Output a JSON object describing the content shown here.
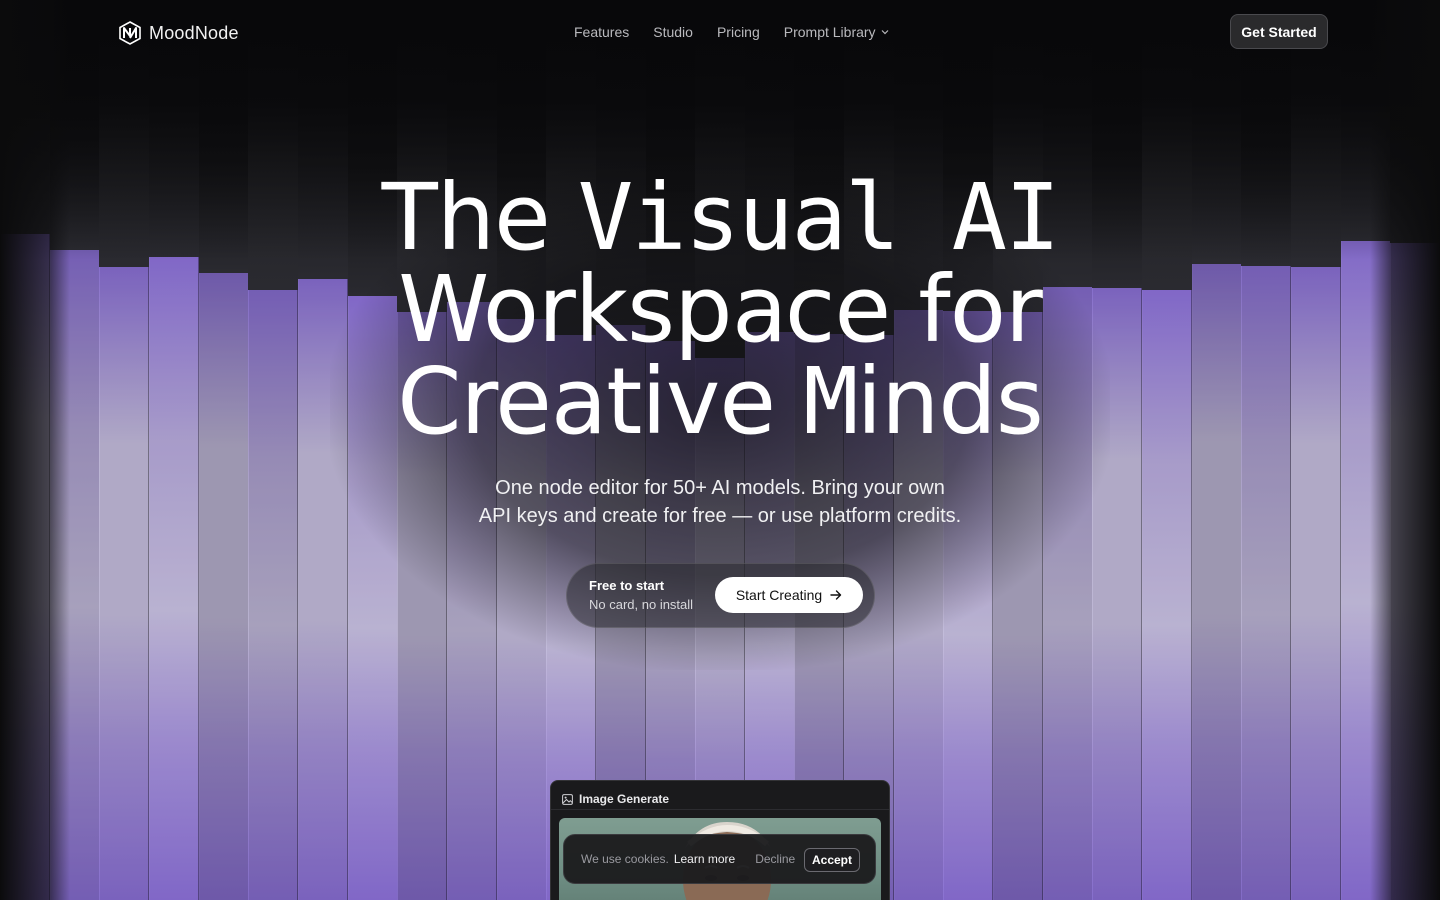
{
  "nav": {
    "brand_name": "MoodNode",
    "links": [
      {
        "label": "Features"
      },
      {
        "label": "Studio"
      },
      {
        "label": "Pricing"
      },
      {
        "label": "Prompt Library"
      }
    ],
    "cta_label": "Get Started"
  },
  "hero": {
    "title_line_1_a": "The ",
    "title_line_1_b": "Visual AI",
    "title_line_2_a": "Worksp",
    "title_line_2_b": "a",
    "title_line_2_c": "ce for",
    "title_line_3_a": "Creative ",
    "title_line_3_b": "M",
    "title_line_3_c": "inds",
    "subtitle_line_1": "One node editor for 50+ AI models. Bring your own",
    "subtitle_line_2": "API keys and create for free — or use platform credits."
  },
  "cta": {
    "note_title": "Free to start",
    "note_sub": "No card, no install",
    "button_label": "Start Creating"
  },
  "node_card": {
    "title": "Image Generate",
    "icon": "image-icon"
  },
  "cookie": {
    "text": "We use cookies.",
    "learn_more": "Learn more",
    "decline": "Decline",
    "accept": "Accept"
  },
  "colors": {
    "background": "#0b0b0c",
    "bar_purple": "#8a6fd6",
    "bar_lilac": "#c7bfe0",
    "button_light": "#ffffff"
  }
}
